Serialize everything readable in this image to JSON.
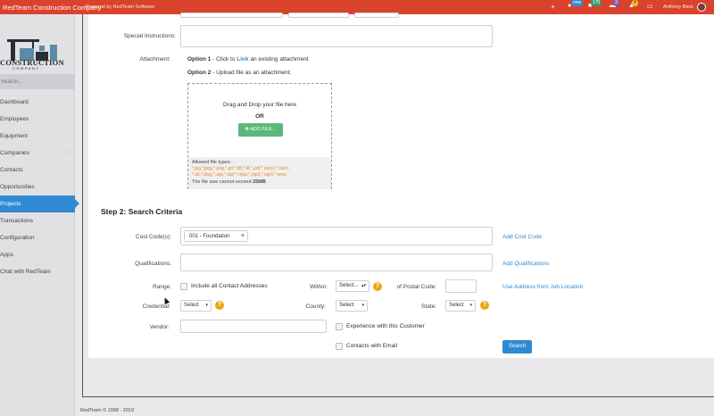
{
  "topbar": {
    "app_title": "RedTeam Construction Company",
    "powered_by": "Powered by RedTeam Software",
    "badges": {
      "new": "new",
      "count_green": "170",
      "count_purple": "3",
      "count_yellow": "4"
    },
    "user_name": "Anthony Beck"
  },
  "sidebar": {
    "logo_word": "CONSTRUCTION",
    "logo_sub": "COMPANY",
    "search_placeholder": "Search...",
    "items": [
      {
        "label": "Dashboard"
      },
      {
        "label": "Employees"
      },
      {
        "label": "Equipment"
      },
      {
        "label": "Companies"
      },
      {
        "label": "Contacts"
      },
      {
        "label": "Opportunities"
      },
      {
        "label": "Projects"
      },
      {
        "label": "Transactions"
      },
      {
        "label": "Configuration"
      },
      {
        "label": "Apps"
      },
      {
        "label": "Chat with RedTeam"
      }
    ]
  },
  "form": {
    "special_instructions_label": "Special Instructions:",
    "attachment_label": "Attachment:",
    "option1_prefix": "Option 1",
    "option1_text": " - Click to ",
    "option1_link": "Link",
    "option1_suffix": " an existing attachment",
    "option2_prefix": "Option 2",
    "option2_text": " - Upload file as an attachment:",
    "drop_text": "Drag and Drop your file here",
    "or_text": "OR",
    "add_file_label": "ADD FILE...",
    "allowed_types_label": "Allowed file types:",
    "allowed_types_line1": "*.jpg,*jpeg,*.png,*.gif,*.tiff,*.tif,*.pdf,*.doc/x,*.xls/x,",
    "allowed_types_line2": "*.txt,*.dwg,*.xps,*.dwf,*.mpp,*.mp3,*.mp4,*.wmv",
    "size_limit_text": "The file size cannot exceed ",
    "size_limit_value": "25MB"
  },
  "search_criteria": {
    "title": "Step 2: Search Criteria",
    "cost_codes_label": "Cost Code(s):",
    "cost_code_tag": "001 - Foundation",
    "add_cost_code": "Add Cost Code",
    "qualifications_label": "Qualifications:",
    "add_qualifications": "Add Qualifications",
    "range_label": "Range:",
    "include_contacts": "Include all Contact Addresses",
    "within_label": "Within:",
    "within_value": "Select...",
    "postal_label": "of Postal Code:",
    "use_address": "Use Address from Job Location",
    "credential_label": "Credential:",
    "credential_value": "Select",
    "county_label": "County:",
    "county_value": "Select",
    "state_label": "State:",
    "state_value": "Select",
    "vendor_label": "Vendor:",
    "experience_label": "Experience with this Customer",
    "contacts_email_label": "Contacts with Email",
    "search_button": "Search"
  },
  "footer": {
    "copyright": "RedTeam © 1998 - 2019"
  },
  "colors": {
    "topbar": "#d9432b",
    "accent": "#2f8ad4",
    "success": "#5cb87a",
    "warning": "#f0a314"
  }
}
